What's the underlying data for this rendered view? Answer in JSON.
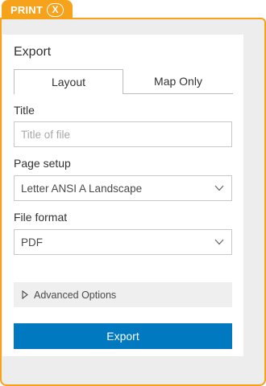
{
  "header": {
    "title": "PRINT",
    "close_label": "X"
  },
  "panel": {
    "title": "Export",
    "tabs": [
      {
        "label": "Layout",
        "active": true
      },
      {
        "label": "Map Only",
        "active": false
      }
    ],
    "title_field": {
      "label": "Title",
      "value": "",
      "placeholder": "Title of file"
    },
    "page_setup": {
      "label": "Page setup",
      "selected": "Letter ANSI A Landscape"
    },
    "file_format": {
      "label": "File format",
      "selected": "PDF"
    },
    "advanced_label": "Advanced Options",
    "export_button": "Export"
  },
  "colors": {
    "accent": "#f7a21b",
    "primary_button": "#0079c1"
  }
}
